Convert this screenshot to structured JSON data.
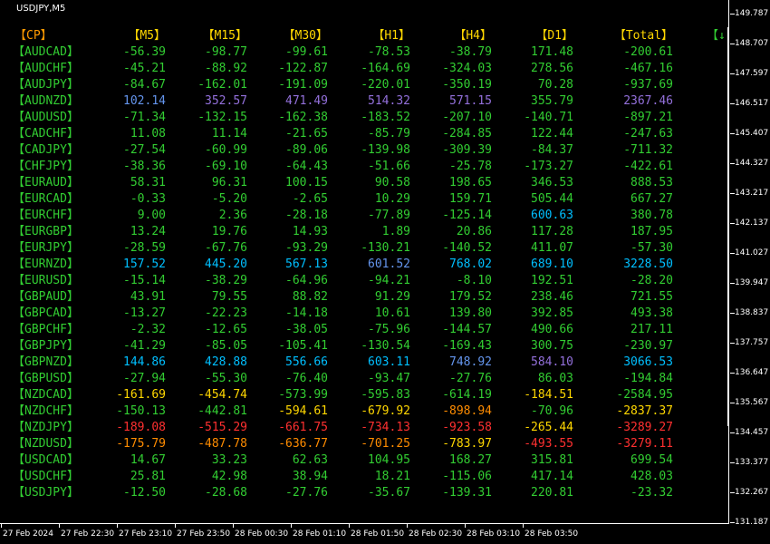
{
  "window": {
    "title": "USDJPY,M5"
  },
  "colors": {
    "background": "#000000",
    "header": "#ffd700",
    "header_cp": "#ff9900",
    "neutral": "#32cd32",
    "strong_pos_blue": "#6495ed",
    "strong_pos_purple": "#9370db",
    "strong_pos_cyan": "#00bfff",
    "neg_yellow": "#ffd700",
    "neg_orange": "#ff8c00",
    "neg_red": "#ff3030"
  },
  "table": {
    "headers": [
      "【CP】",
      "【M5】",
      "【M15】",
      "【M30】",
      "【H1】",
      "【H4】",
      "【D1】",
      "【Total】"
    ],
    "sort_indicator": "【↓",
    "rows": [
      {
        "pair": "【AUDCAD】",
        "values": [
          "-56.39",
          "-98.77",
          "-99.61",
          "-78.53",
          "-38.79",
          "171.48",
          "-200.61"
        ],
        "colors": [
          "n",
          "n",
          "n",
          "n",
          "n",
          "n",
          "n"
        ]
      },
      {
        "pair": "【AUDCHF】",
        "values": [
          "-45.21",
          "-88.92",
          "-122.87",
          "-164.69",
          "-324.03",
          "278.56",
          "-467.16"
        ],
        "colors": [
          "n",
          "n",
          "n",
          "n",
          "n",
          "n",
          "n"
        ]
      },
      {
        "pair": "【AUDJPY】",
        "values": [
          "-84.67",
          "-162.01",
          "-191.09",
          "-220.01",
          "-350.19",
          "70.28",
          "-937.69"
        ],
        "colors": [
          "n",
          "n",
          "n",
          "n",
          "n",
          "n",
          "n"
        ]
      },
      {
        "pair": "【AUDNZD】",
        "values": [
          "102.14",
          "352.57",
          "471.49",
          "514.32",
          "571.15",
          "355.79",
          "2367.46"
        ],
        "colors": [
          "b",
          "p",
          "p",
          "p",
          "p",
          "n",
          "p"
        ]
      },
      {
        "pair": "【AUDUSD】",
        "values": [
          "-71.34",
          "-132.15",
          "-162.38",
          "-183.52",
          "-207.10",
          "-140.71",
          "-897.21"
        ],
        "colors": [
          "n",
          "n",
          "n",
          "n",
          "n",
          "n",
          "n"
        ]
      },
      {
        "pair": "【CADCHF】",
        "values": [
          "11.08",
          "11.14",
          "-21.65",
          "-85.79",
          "-284.85",
          "122.44",
          "-247.63"
        ],
        "colors": [
          "n",
          "n",
          "n",
          "n",
          "n",
          "n",
          "n"
        ]
      },
      {
        "pair": "【CADJPY】",
        "values": [
          "-27.54",
          "-60.99",
          "-89.06",
          "-139.98",
          "-309.39",
          "-84.37",
          "-711.32"
        ],
        "colors": [
          "n",
          "n",
          "n",
          "n",
          "n",
          "n",
          "n"
        ]
      },
      {
        "pair": "【CHFJPY】",
        "values": [
          "-38.36",
          "-69.10",
          "-64.43",
          "-51.66",
          "-25.78",
          "-173.27",
          "-422.61"
        ],
        "colors": [
          "n",
          "n",
          "n",
          "n",
          "n",
          "n",
          "n"
        ]
      },
      {
        "pair": "【EURAUD】",
        "values": [
          "58.31",
          "96.31",
          "100.15",
          "90.58",
          "198.65",
          "346.53",
          "888.53"
        ],
        "colors": [
          "n",
          "n",
          "n",
          "n",
          "n",
          "n",
          "n"
        ]
      },
      {
        "pair": "【EURCAD】",
        "values": [
          "-0.33",
          "-5.20",
          "-2.65",
          "10.29",
          "159.71",
          "505.44",
          "667.27"
        ],
        "colors": [
          "n",
          "n",
          "n",
          "n",
          "n",
          "n",
          "n"
        ]
      },
      {
        "pair": "【EURCHF】",
        "values": [
          "9.00",
          "2.36",
          "-28.18",
          "-77.89",
          "-125.14",
          "600.63",
          "380.78"
        ],
        "colors": [
          "n",
          "n",
          "n",
          "n",
          "n",
          "c",
          "n"
        ]
      },
      {
        "pair": "【EURGBP】",
        "values": [
          "13.24",
          "19.76",
          "14.93",
          "1.89",
          "20.86",
          "117.28",
          "187.95"
        ],
        "colors": [
          "n",
          "n",
          "n",
          "n",
          "n",
          "n",
          "n"
        ]
      },
      {
        "pair": "【EURJPY】",
        "values": [
          "-28.59",
          "-67.76",
          "-93.29",
          "-130.21",
          "-140.52",
          "411.07",
          "-57.30"
        ],
        "colors": [
          "n",
          "n",
          "n",
          "n",
          "n",
          "n",
          "n"
        ]
      },
      {
        "pair": "【EURNZD】",
        "values": [
          "157.52",
          "445.20",
          "567.13",
          "601.52",
          "768.02",
          "689.10",
          "3228.50"
        ],
        "colors": [
          "c",
          "c",
          "c",
          "b",
          "c",
          "c",
          "c"
        ]
      },
      {
        "pair": "【EURUSD】",
        "values": [
          "-15.14",
          "-38.29",
          "-64.96",
          "-94.21",
          "-8.10",
          "192.51",
          "-28.20"
        ],
        "colors": [
          "n",
          "n",
          "n",
          "n",
          "n",
          "n",
          "n"
        ]
      },
      {
        "pair": "【GBPAUD】",
        "values": [
          "43.91",
          "79.55",
          "88.82",
          "91.29",
          "179.52",
          "238.46",
          "721.55"
        ],
        "colors": [
          "n",
          "n",
          "n",
          "n",
          "n",
          "n",
          "n"
        ]
      },
      {
        "pair": "【GBPCAD】",
        "values": [
          "-13.27",
          "-22.23",
          "-14.18",
          "10.61",
          "139.80",
          "392.85",
          "493.38"
        ],
        "colors": [
          "n",
          "n",
          "n",
          "n",
          "n",
          "n",
          "n"
        ]
      },
      {
        "pair": "【GBPCHF】",
        "values": [
          "-2.32",
          "-12.65",
          "-38.05",
          "-75.96",
          "-144.57",
          "490.66",
          "217.11"
        ],
        "colors": [
          "n",
          "n",
          "n",
          "n",
          "n",
          "n",
          "n"
        ]
      },
      {
        "pair": "【GBPJPY】",
        "values": [
          "-41.29",
          "-85.05",
          "-105.41",
          "-130.54",
          "-169.43",
          "300.75",
          "-230.97"
        ],
        "colors": [
          "n",
          "n",
          "n",
          "n",
          "n",
          "n",
          "n"
        ]
      },
      {
        "pair": "【GBPNZD】",
        "values": [
          "144.86",
          "428.88",
          "556.66",
          "603.11",
          "748.92",
          "584.10",
          "3066.53"
        ],
        "colors": [
          "c",
          "c",
          "c",
          "c",
          "b",
          "p",
          "c"
        ]
      },
      {
        "pair": "【GBPUSD】",
        "values": [
          "-27.94",
          "-55.30",
          "-76.40",
          "-93.47",
          "-27.76",
          "86.03",
          "-194.84"
        ],
        "colors": [
          "n",
          "n",
          "n",
          "n",
          "n",
          "n",
          "n"
        ]
      },
      {
        "pair": "【NZDCAD】",
        "values": [
          "-161.69",
          "-454.74",
          "-573.99",
          "-595.83",
          "-614.19",
          "-184.51",
          "-2584.95"
        ],
        "colors": [
          "y",
          "y",
          "n",
          "n",
          "n",
          "y",
          "n"
        ]
      },
      {
        "pair": "【NZDCHF】",
        "values": [
          "-150.13",
          "-442.81",
          "-594.61",
          "-679.92",
          "-898.94",
          "-70.96",
          "-2837.37"
        ],
        "colors": [
          "n",
          "n",
          "y",
          "y",
          "o",
          "n",
          "y"
        ]
      },
      {
        "pair": "【NZDJPY】",
        "values": [
          "-189.08",
          "-515.29",
          "-661.75",
          "-734.13",
          "-923.58",
          "-265.44",
          "-3289.27"
        ],
        "colors": [
          "r",
          "r",
          "r",
          "r",
          "r",
          "y",
          "r"
        ]
      },
      {
        "pair": "【NZDUSD】",
        "values": [
          "-175.79",
          "-487.78",
          "-636.77",
          "-701.25",
          "-783.97",
          "-493.55",
          "-3279.11"
        ],
        "colors": [
          "o",
          "o",
          "o",
          "o",
          "y",
          "r",
          "r"
        ]
      },
      {
        "pair": "【USDCAD】",
        "values": [
          "14.67",
          "33.23",
          "62.63",
          "104.95",
          "168.27",
          "315.81",
          "699.54"
        ],
        "colors": [
          "n",
          "n",
          "n",
          "n",
          "n",
          "n",
          "n"
        ]
      },
      {
        "pair": "【USDCHF】",
        "values": [
          "25.81",
          "42.98",
          "38.94",
          "18.21",
          "-115.06",
          "417.14",
          "428.03"
        ],
        "colors": [
          "n",
          "n",
          "n",
          "n",
          "n",
          "n",
          "n"
        ]
      },
      {
        "pair": "【USDJPY】",
        "values": [
          "-12.50",
          "-28.68",
          "-27.76",
          "-35.67",
          "-139.31",
          "220.81",
          "-23.32"
        ],
        "colors": [
          "n",
          "n",
          "n",
          "n",
          "n",
          "n",
          "n"
        ]
      }
    ]
  },
  "price_axis": [
    "149.787",
    "148.707",
    "147.597",
    "146.517",
    "145.407",
    "144.327",
    "143.217",
    "142.137",
    "141.027",
    "139.947",
    "138.837",
    "137.757",
    "136.647",
    "135.567",
    "134.457",
    "133.377",
    "132.267",
    "131.187"
  ],
  "time_axis": [
    "27 Feb 2024",
    "27 Feb 22:30",
    "27 Feb 23:10",
    "27 Feb 23:50",
    "28 Feb 00:30",
    "28 Feb 01:10",
    "28 Feb 01:50",
    "28 Feb 02:30",
    "28 Feb 03:10",
    "28 Feb 03:50"
  ]
}
